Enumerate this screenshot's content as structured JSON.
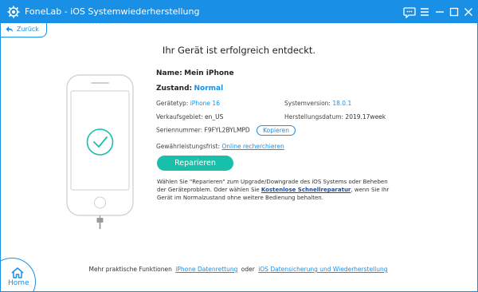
{
  "window": {
    "title": "FoneLab - iOS Systemwiederherstellung",
    "icons": [
      "app-gear-icon",
      "feedback-icon",
      "menu-icon",
      "minimize-icon",
      "maximize-icon",
      "close-icon"
    ],
    "accent_color": "#1a8fe6"
  },
  "nav": {
    "back_label": "Zurück"
  },
  "main": {
    "heading": "Ihr Gerät ist erfolgreich entdeckt.",
    "name_label": "Name:",
    "name_value": "Mein iPhone",
    "status_label": "Zustand:",
    "status_value": "Normal",
    "device_type_label": "Gerätetyp:",
    "device_type_value": "iPhone 16",
    "system_version_label": "Systemversion:",
    "system_version_value": "18.0.1",
    "sales_region_label": "Verkaufsgebiet:",
    "sales_region_value": "en_US",
    "manufacture_date_label": "Herstellungsdatum:",
    "manufacture_date_value": "2019.17week",
    "serial_label": "Seriennummer:",
    "serial_value": "F9FYL2BYLMPD",
    "copy_button": "Kopieren",
    "warranty_label": "Gewährleistungsfrist:",
    "warranty_link": "Online recherchieren",
    "repair_button": "Reparieren",
    "repair_button_color": "#19c0a9",
    "description_part1": "Wählen Sie \"Reparieren\" zum Upgrade/Downgrade des iOS Systems oder Beheben der Geräteproblem. Oder wählen Sie ",
    "description_link": "Kostenlose Schnellreparatur",
    "description_part2": ", wenn Sie Ihr Gerät im Normalzustand ohne weitere Bedienung behalten."
  },
  "footer": {
    "prefix": "Mehr praktische Funktionen",
    "link1": "iPhone Datenrettung",
    "separator": "oder",
    "link2": "iOS Datensicherung und Wiederherstellung"
  },
  "home": {
    "label": "Home"
  }
}
